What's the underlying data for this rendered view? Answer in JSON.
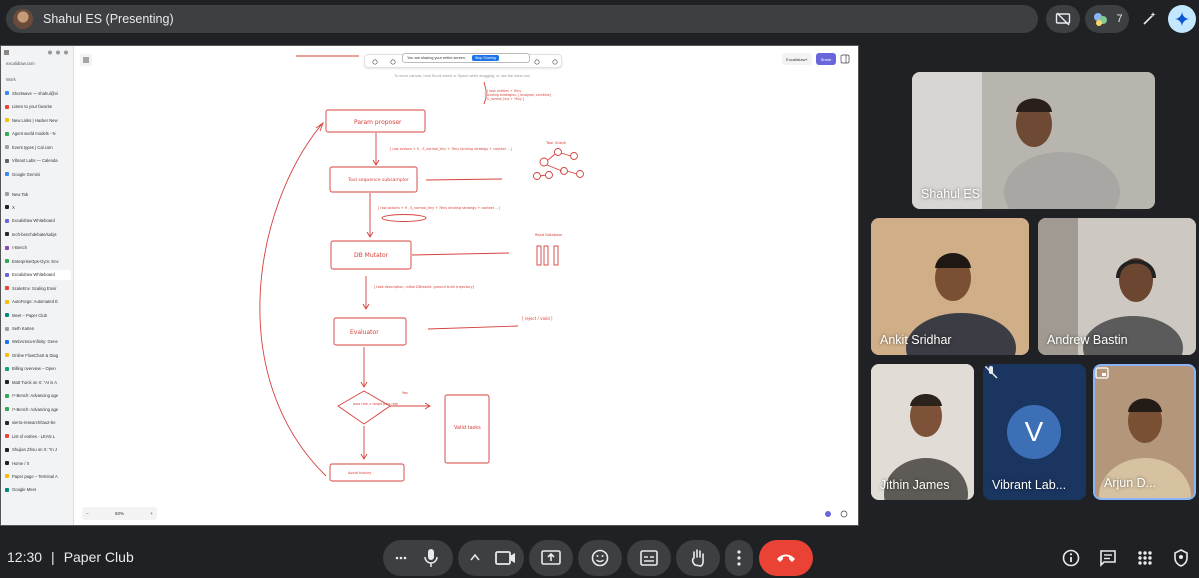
{
  "presenter": {
    "label": "Shahul ES (Presenting)"
  },
  "top_actions": {
    "people_count": "7"
  },
  "shared_screen": {
    "sidebar_tabs": [
      "Shortwave — shahul@vi",
      "Listen to your favorite",
      "New Links | Hacker New",
      "Agent world models - N",
      "Event types | Cal.com",
      "Vibrant Labs — Calenda",
      "Google Gemini",
      "New Tab",
      "X",
      "Excalidraw Whiteboard",
      "tech-benchdebate/subjs",
      "τ-Bench",
      "EnterpriseOps-Gym: Env",
      "Excalidraw Whiteboard",
      "ScaleEnv: Scaling Envir",
      "AutoForge: Automated E",
      "Meet – Paper Club",
      "Seth Karten",
      "WebArena-Infinity: Gene",
      "Online FlowChart & Diag",
      "Billing overview – Open",
      "Matt Turck on X: \"AI is A",
      "τ²-Bench: Advancing age",
      "τ³-Bench: Advancing age",
      "sierra-research/tau2-be",
      "List of entries - LEAN L",
      "Shujian Zhou on X: \"In J",
      "Home / X",
      "Paper page – Terminal A",
      "Google Meet"
    ],
    "url": "excalidraw.com",
    "sidebar_section_label": "Work",
    "share_banner": "You are sharing your entire screen.",
    "stop_sharing": "Stop Sharing",
    "hint": "To move canvas, hold Scroll wheel or Space while dragging, or use the hand tool",
    "library_label": "Excalidraw+",
    "share_label": "Share",
    "zoom": "50%",
    "diagram": {
      "node_param": "Param proposer",
      "node_tool": "Tool sequence subsampler",
      "node_db": "DB Mutator",
      "node_eval": "Evaluator",
      "node_valid": "Valid tasks",
      "node_diamond": "pass rate ≥ target pass rate",
      "node_bottom": "Avoid history",
      "edge1": "[ raw actions + θ , S_normal_tiny + ?tiny binding strategy + context ...]",
      "edge2": "[ raw actions + θ , S_normal_tiny + ?tiny binding strategy + context ...]",
      "edge3": "[ task description, initial DB/world, ground truth trajectory]",
      "edge_eval": "[ reject / valid ]",
      "note_top_1": "[ task entities + ?tiny",
      "note_top_2": "binding strategies: [ disagree, combine]",
      "note_top_3": "S_normal_tiny + ?tiny ]",
      "note_tool": "Tool Graph",
      "note_db": "Read Database",
      "yes_label": "Yes"
    }
  },
  "participants": [
    {
      "name": "Shahul ES"
    },
    {
      "name": "Ankit Sridhar"
    },
    {
      "name": "Andrew Bastin"
    },
    {
      "name": "Jithin James"
    },
    {
      "name": "Vibrant Lab...",
      "initial": "V"
    },
    {
      "name": "Arjun D..."
    }
  ],
  "meeting": {
    "time": "12:30",
    "separator": "|",
    "name": "Paper Club"
  },
  "colors": {
    "end_call": "#ea4335",
    "diagram": "#d6403b",
    "bg": "#202124"
  }
}
